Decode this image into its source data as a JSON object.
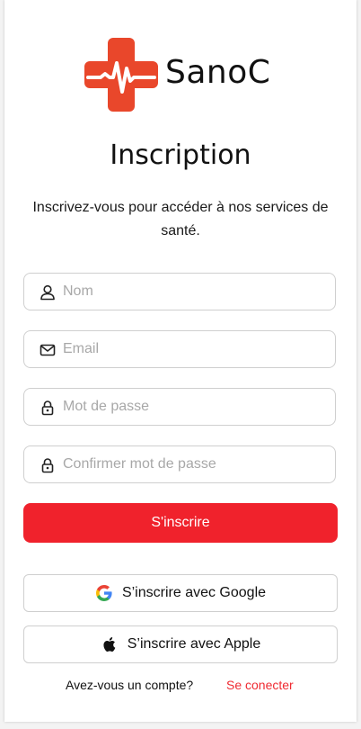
{
  "brand": {
    "name": "SanoC",
    "accent": "#f0222c"
  },
  "page": {
    "title": "Inscription",
    "subtitle": "Inscrivez-vous pour accéder à nos services de santé."
  },
  "form": {
    "fields": [
      {
        "icon": "user-icon",
        "placeholder": "Nom",
        "value": ""
      },
      {
        "icon": "mail-icon",
        "placeholder": "Email",
        "value": ""
      },
      {
        "icon": "lock-icon",
        "placeholder": "Mot de passe",
        "value": ""
      },
      {
        "icon": "lock-icon",
        "placeholder": "Confirmer mot de passe",
        "value": ""
      }
    ],
    "submit_label": "S'inscrire"
  },
  "social": {
    "google_label": "S’inscrire avec Google",
    "apple_label": "S’inscrire avec Apple"
  },
  "footer": {
    "question": "Avez-vous un compte?",
    "link_label": "Se conecter"
  }
}
